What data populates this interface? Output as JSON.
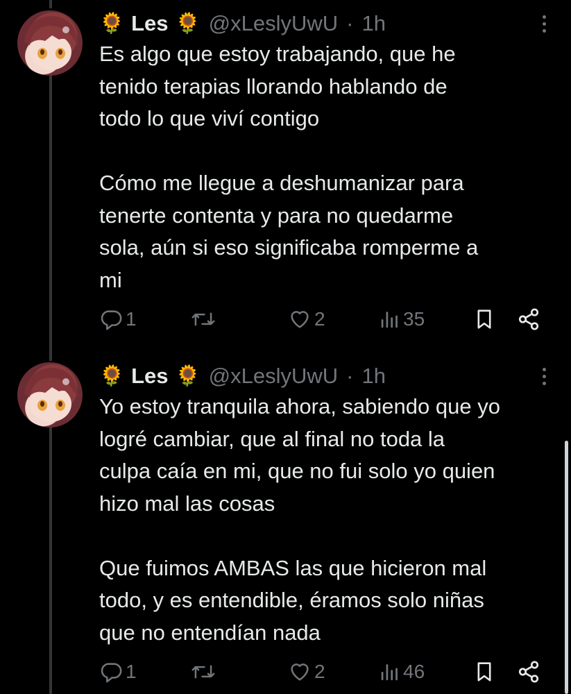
{
  "tweets": [
    {
      "display_name": "Les",
      "emoji_left": "🌻",
      "emoji_right": "🌻",
      "handle": "@xLeslyUwU",
      "separator": "·",
      "time": "1h",
      "text": "Es algo que estoy trabajando, que he\ntenido terapias llorando hablando de\ntodo lo que viví contigo\n\nCómo me llegue a deshumanizar para\ntenerte contenta y para no quedarme\nsola, aún si eso significaba romperme a\nmi",
      "replies": "1",
      "likes": "2",
      "views": "35",
      "icons": [
        "reply-icon",
        "retweet-icon",
        "like-icon",
        "views-icon",
        "bookmark-icon",
        "share-icon",
        "more-icon"
      ]
    },
    {
      "display_name": "Les",
      "emoji_left": "🌻",
      "emoji_right": "🌻",
      "handle": "@xLeslyUwU",
      "separator": "·",
      "time": "1h",
      "text": "Yo estoy tranquila ahora, sabiendo que yo\nlogré cambiar, que al final no toda la\nculpa caía en mi, que no fui solo yo quien\nhizo mal las cosas\n\nQue fuimos AMBAS las que hicieron mal\ntodo, y es entendible, éramos solo niñas\nque no entendían nada",
      "replies": "1",
      "likes": "2",
      "views": "46",
      "icons": [
        "reply-icon",
        "retweet-icon",
        "like-icon",
        "views-icon",
        "bookmark-icon",
        "share-icon",
        "more-icon"
      ]
    }
  ],
  "colors": {
    "background": "#000000",
    "text": "#e7e9ea",
    "secondary": "#71767b",
    "thread_line": "#333639"
  }
}
